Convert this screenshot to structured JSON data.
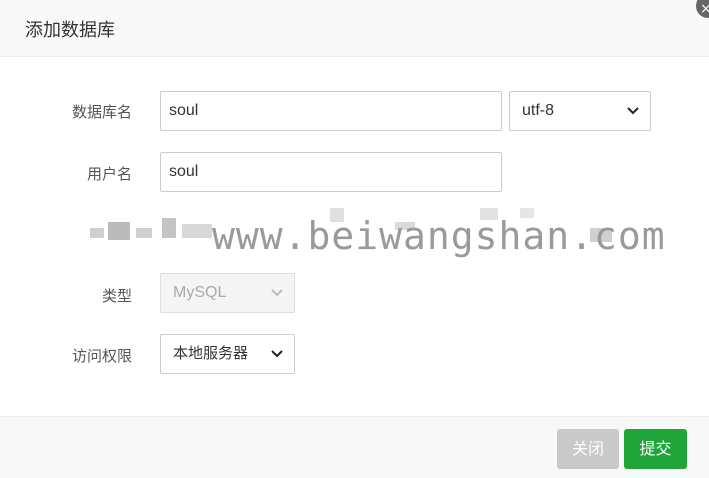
{
  "dialog": {
    "title": "添加数据库",
    "close_glyph": "×"
  },
  "form": {
    "db_name_label": "数据库名",
    "db_name_value": "soul",
    "charset_value": "utf-8",
    "username_label": "用户名",
    "username_value": "soul",
    "watermark_text": "www.beiwangshan.com",
    "type_label": "类型",
    "type_value": "MySQL",
    "access_label": "访问权限",
    "access_value": "本地服务器"
  },
  "footer": {
    "close_label": "关闭",
    "submit_label": "提交"
  },
  "colors": {
    "submit_green": "#20a53a",
    "close_gray": "#c9c9c9"
  }
}
